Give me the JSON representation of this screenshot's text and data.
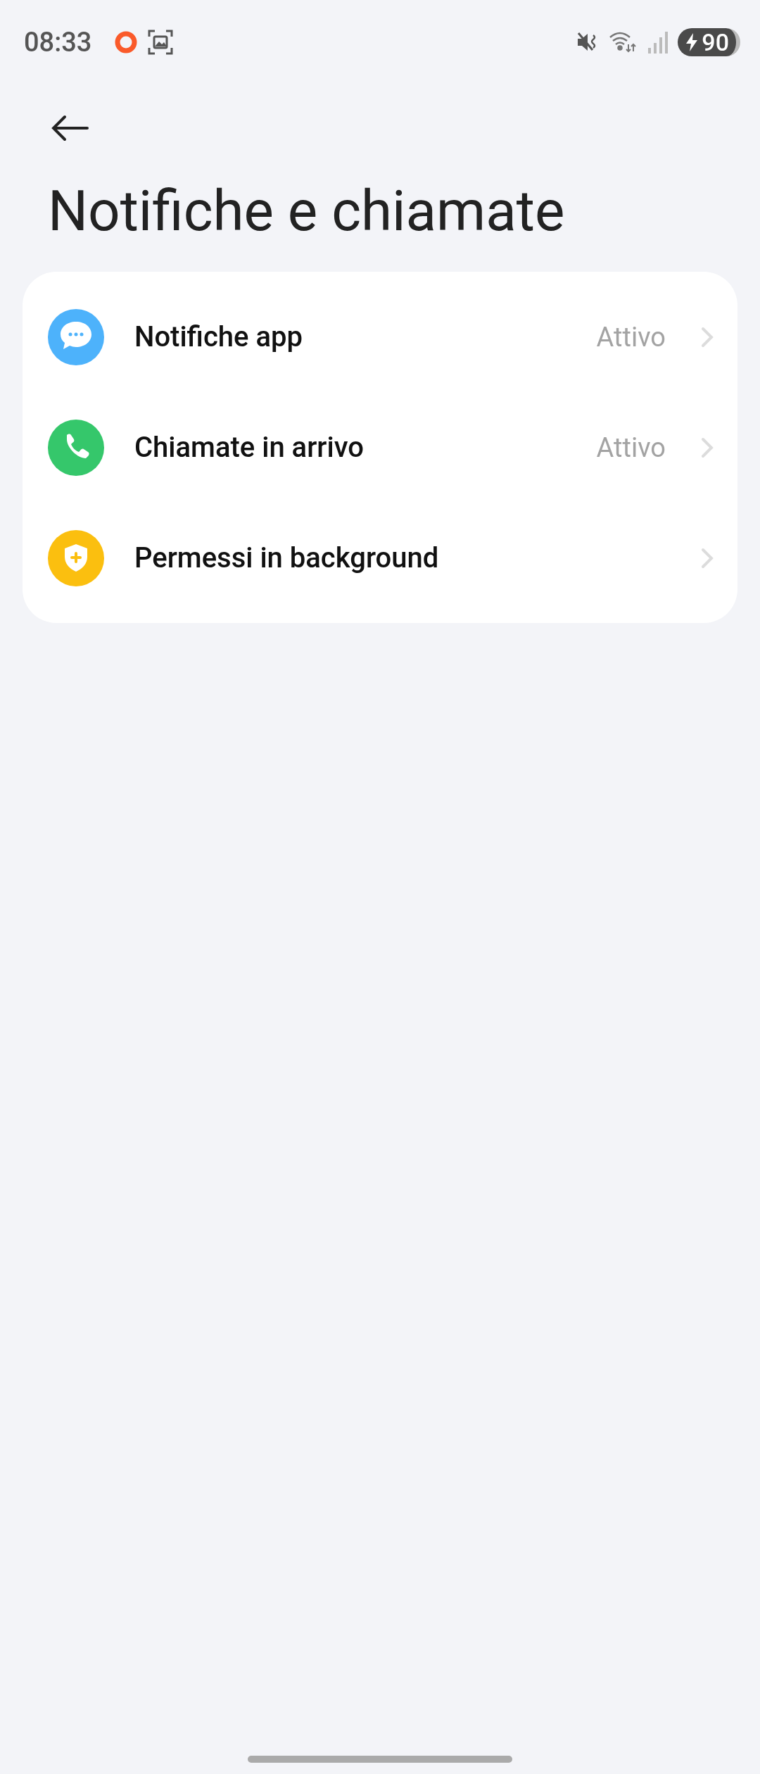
{
  "status_bar": {
    "time": "08:33",
    "battery": "90"
  },
  "title": "Notifiche e chiamate",
  "items": [
    {
      "kind": "chat",
      "color": "#4db2fb",
      "label": "Notifiche app",
      "value": "Attivo"
    },
    {
      "kind": "phone",
      "color": "#35c76b",
      "label": "Chiamate in arrivo",
      "value": "Attivo"
    },
    {
      "kind": "shield",
      "color": "#fbbf0f",
      "label": "Permessi in background"
    }
  ]
}
